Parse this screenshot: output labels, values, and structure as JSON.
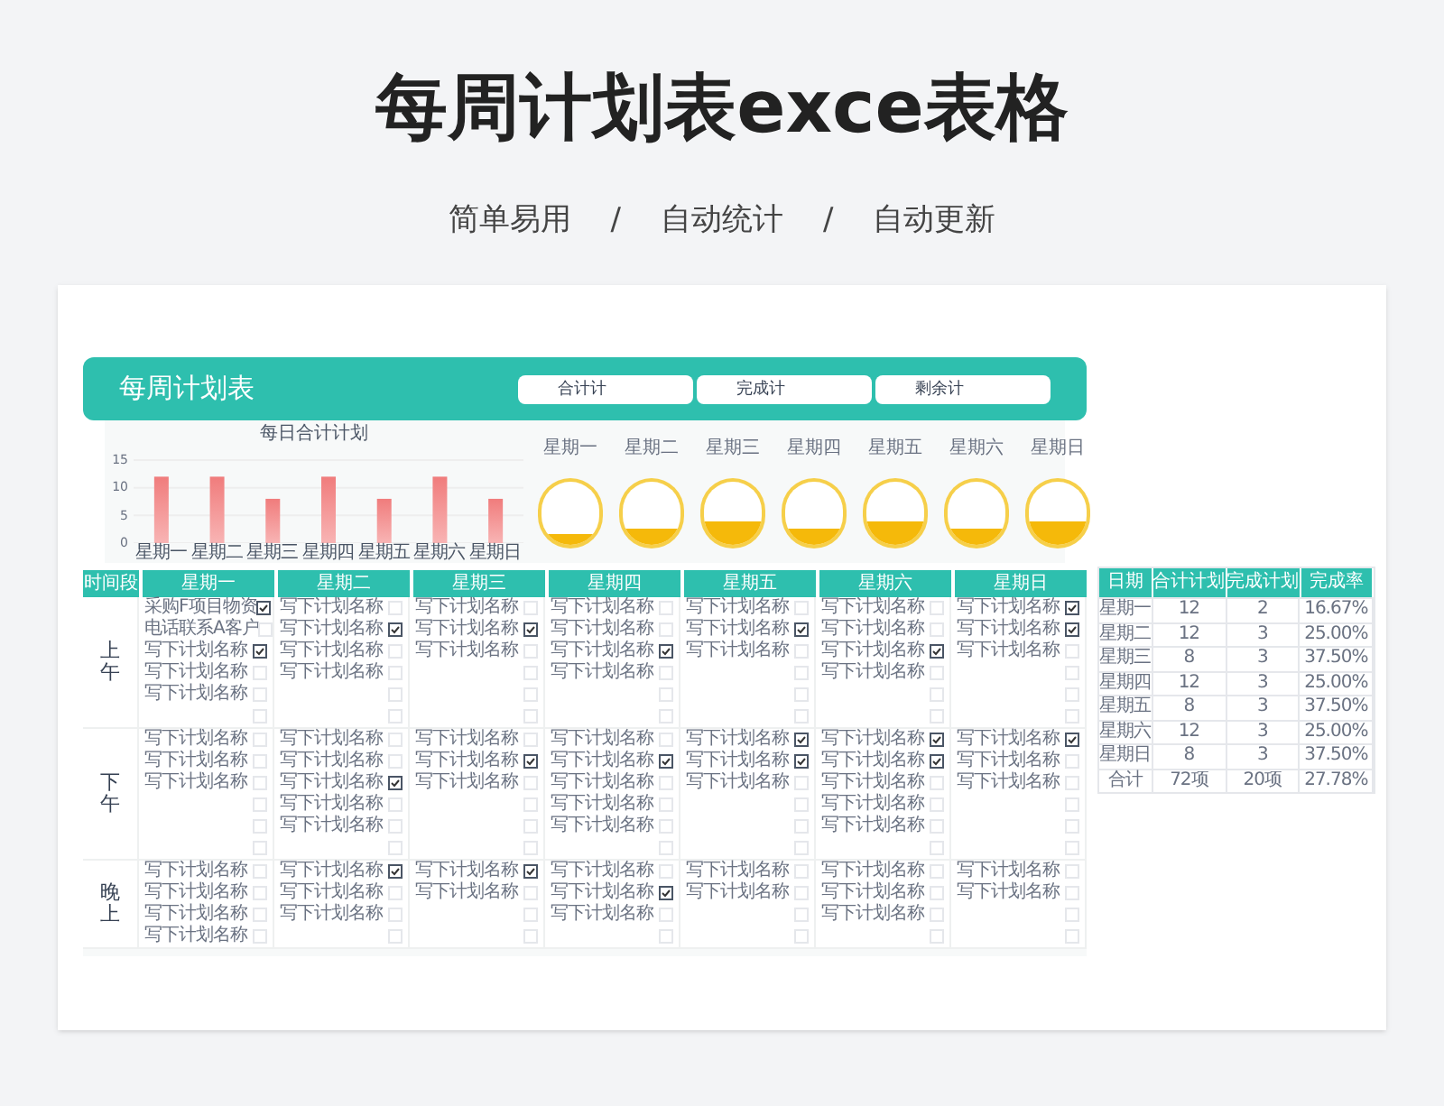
{
  "title": "每周计划表exce表格",
  "subtitle": [
    "简单易用",
    "/",
    "自动统计",
    "/",
    "自动更新"
  ],
  "planner": {
    "title": "每周计划表",
    "summary_buttons": [
      "合计计",
      "完成计",
      "剩余计"
    ],
    "chart_data": {
      "type": "bar",
      "title": "每日合计计划",
      "categories": [
        "星期一",
        "星期二",
        "星期三",
        "星期四",
        "星期五",
        "星期六",
        "星期日"
      ],
      "values": [
        12,
        12,
        8,
        12,
        8,
        12,
        8
      ],
      "ylim": [
        0,
        15
      ],
      "yticks": [
        0,
        5,
        10,
        15
      ]
    },
    "progress": [
      {
        "day": "星期一",
        "level": 0.1667
      },
      {
        "day": "星期二",
        "level": 0.25
      },
      {
        "day": "星期三",
        "level": 0.375
      },
      {
        "day": "星期四",
        "level": 0.25
      },
      {
        "day": "星期五",
        "level": 0.375
      },
      {
        "day": "星期六",
        "level": 0.25
      },
      {
        "day": "星期日",
        "level": 0.375
      }
    ],
    "table": {
      "columns": [
        "时间段",
        "星期一",
        "星期二",
        "星期三",
        "星期四",
        "星期五",
        "星期六",
        "星期日"
      ],
      "periods": [
        {
          "label": "上午",
          "days": [
            [
              {
                "text": "采购F项目物资",
                "checked": true
              },
              {
                "text": "电话联系A客户",
                "checked": false
              },
              {
                "text": "写下计划名称",
                "checked": true
              },
              {
                "text": "写下计划名称",
                "checked": false
              },
              {
                "text": "写下计划名称",
                "checked": false
              },
              {
                "checked": false
              }
            ],
            [
              {
                "text": "写下计划名称",
                "checked": false
              },
              {
                "text": "写下计划名称",
                "checked": true
              },
              {
                "text": "写下计划名称",
                "checked": false
              },
              {
                "text": "写下计划名称",
                "checked": false
              },
              {
                "checked": false
              },
              {
                "checked": false
              }
            ],
            [
              {
                "text": "写下计划名称",
                "checked": false
              },
              {
                "text": "写下计划名称",
                "checked": true
              },
              {
                "text": "写下计划名称",
                "checked": false
              },
              {
                "checked": false
              },
              {
                "checked": false
              },
              {
                "checked": false
              }
            ],
            [
              {
                "text": "写下计划名称",
                "checked": false
              },
              {
                "text": "写下计划名称",
                "checked": false
              },
              {
                "text": "写下计划名称",
                "checked": true
              },
              {
                "text": "写下计划名称",
                "checked": false
              },
              {
                "checked": false
              },
              {
                "checked": false
              }
            ],
            [
              {
                "text": "写下计划名称",
                "checked": false
              },
              {
                "text": "写下计划名称",
                "checked": true
              },
              {
                "text": "写下计划名称",
                "checked": false
              },
              {
                "checked": false
              },
              {
                "checked": false
              },
              {
                "checked": false
              }
            ],
            [
              {
                "text": "写下计划名称",
                "checked": false
              },
              {
                "text": "写下计划名称",
                "checked": false
              },
              {
                "text": "写下计划名称",
                "checked": true
              },
              {
                "text": "写下计划名称",
                "checked": false
              },
              {
                "checked": false
              },
              {
                "checked": false
              }
            ],
            [
              {
                "text": "写下计划名称",
                "checked": true
              },
              {
                "text": "写下计划名称",
                "checked": true
              },
              {
                "text": "写下计划名称",
                "checked": false
              },
              {
                "checked": false
              },
              {
                "checked": false
              },
              {
                "checked": false
              }
            ]
          ]
        },
        {
          "label": "下午",
          "days": [
            [
              {
                "text": "写下计划名称",
                "checked": false
              },
              {
                "text": "写下计划名称",
                "checked": false
              },
              {
                "text": "写下计划名称",
                "checked": false
              },
              {
                "checked": false
              },
              {
                "checked": false
              },
              {
                "checked": false
              }
            ],
            [
              {
                "text": "写下计划名称",
                "checked": false
              },
              {
                "text": "写下计划名称",
                "checked": false
              },
              {
                "text": "写下计划名称",
                "checked": true
              },
              {
                "text": "写下计划名称",
                "checked": false
              },
              {
                "text": "写下计划名称",
                "checked": false
              },
              {
                "checked": false
              }
            ],
            [
              {
                "text": "写下计划名称",
                "checked": false
              },
              {
                "text": "写下计划名称",
                "checked": true
              },
              {
                "text": "写下计划名称",
                "checked": false
              },
              {
                "checked": false
              },
              {
                "checked": false
              },
              {
                "checked": false
              }
            ],
            [
              {
                "text": "写下计划名称",
                "checked": false
              },
              {
                "text": "写下计划名称",
                "checked": true
              },
              {
                "text": "写下计划名称",
                "checked": false
              },
              {
                "text": "写下计划名称",
                "checked": false
              },
              {
                "text": "写下计划名称",
                "checked": false
              },
              {
                "checked": false
              }
            ],
            [
              {
                "text": "写下计划名称",
                "checked": true
              },
              {
                "text": "写下计划名称",
                "checked": true
              },
              {
                "text": "写下计划名称",
                "checked": false
              },
              {
                "checked": false
              },
              {
                "checked": false
              },
              {
                "checked": false
              }
            ],
            [
              {
                "text": "写下计划名称",
                "checked": true
              },
              {
                "text": "写下计划名称",
                "checked": true
              },
              {
                "text": "写下计划名称",
                "checked": false
              },
              {
                "text": "写下计划名称",
                "checked": false
              },
              {
                "text": "写下计划名称",
                "checked": false
              },
              {
                "checked": false
              }
            ],
            [
              {
                "text": "写下计划名称",
                "checked": true
              },
              {
                "text": "写下计划名称",
                "checked": false
              },
              {
                "text": "写下计划名称",
                "checked": false
              },
              {
                "checked": false
              },
              {
                "checked": false
              },
              {
                "checked": false
              }
            ]
          ]
        },
        {
          "label": "晚上",
          "days": [
            [
              {
                "text": "写下计划名称",
                "checked": false
              },
              {
                "text": "写下计划名称",
                "checked": false
              },
              {
                "text": "写下计划名称",
                "checked": false
              },
              {
                "text": "写下计划名称",
                "checked": false
              }
            ],
            [
              {
                "text": "写下计划名称",
                "checked": true
              },
              {
                "text": "写下计划名称",
                "checked": false
              },
              {
                "text": "写下计划名称",
                "checked": false
              },
              {
                "checked": false
              }
            ],
            [
              {
                "text": "写下计划名称",
                "checked": true
              },
              {
                "text": "写下计划名称",
                "checked": false
              },
              {
                "checked": false
              },
              {
                "checked": false
              }
            ],
            [
              {
                "text": "写下计划名称",
                "checked": false
              },
              {
                "text": "写下计划名称",
                "checked": true
              },
              {
                "text": "写下计划名称",
                "checked": false
              },
              {
                "checked": false
              }
            ],
            [
              {
                "text": "写下计划名称",
                "checked": false
              },
              {
                "text": "写下计划名称",
                "checked": false
              },
              {
                "checked": false
              },
              {
                "checked": false
              }
            ],
            [
              {
                "text": "写下计划名称",
                "checked": false
              },
              {
                "text": "写下计划名称",
                "checked": false
              },
              {
                "text": "写下计划名称",
                "checked": false
              },
              {
                "checked": false
              }
            ],
            [
              {
                "text": "写下计划名称",
                "checked": false
              },
              {
                "text": "写下计划名称",
                "checked": false
              },
              {
                "checked": false
              },
              {
                "checked": false
              }
            ]
          ]
        }
      ]
    }
  },
  "summary_table": {
    "columns": [
      "日期",
      "合计计划",
      "完成计划",
      "完成率"
    ],
    "rows": [
      [
        "星期一",
        "12",
        "2",
        "16.67%"
      ],
      [
        "星期二",
        "12",
        "3",
        "25.00%"
      ],
      [
        "星期三",
        "8",
        "3",
        "37.50%"
      ],
      [
        "星期四",
        "12",
        "3",
        "25.00%"
      ],
      [
        "星期五",
        "8",
        "3",
        "37.50%"
      ],
      [
        "星期六",
        "12",
        "3",
        "25.00%"
      ],
      [
        "星期日",
        "8",
        "3",
        "37.50%"
      ],
      [
        "合计",
        "72项",
        "20项",
        "27.78%"
      ]
    ]
  }
}
